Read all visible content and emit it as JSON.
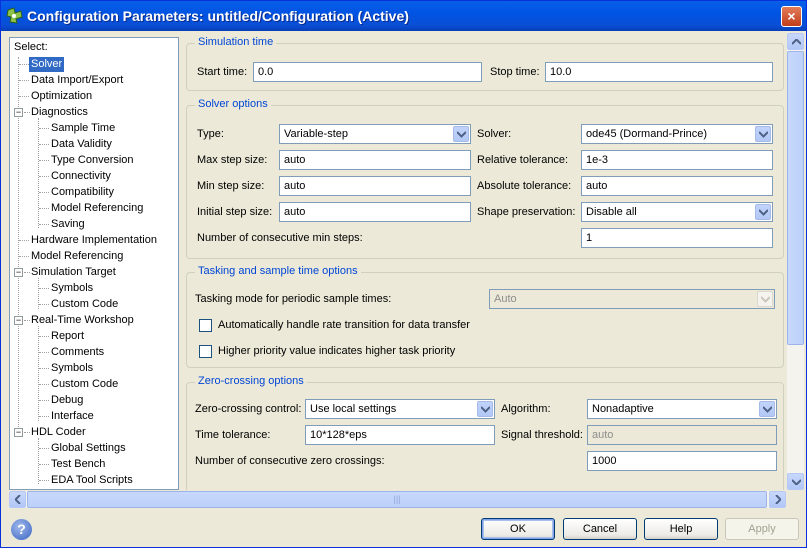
{
  "window": {
    "title": "Configuration Parameters: untitled/Configuration (Active)",
    "close": "×"
  },
  "tree": {
    "header": "Select:",
    "items": [
      {
        "label": "Solver"
      },
      {
        "label": "Data Import/Export"
      },
      {
        "label": "Optimization"
      },
      {
        "label": "Diagnostics"
      },
      {
        "label": "Sample Time"
      },
      {
        "label": "Data Validity"
      },
      {
        "label": "Type Conversion"
      },
      {
        "label": "Connectivity"
      },
      {
        "label": "Compatibility"
      },
      {
        "label": "Model Referencing"
      },
      {
        "label": "Saving"
      },
      {
        "label": "Hardware Implementation"
      },
      {
        "label": "Model Referencing"
      },
      {
        "label": "Simulation Target"
      },
      {
        "label": "Symbols"
      },
      {
        "label": "Custom Code"
      },
      {
        "label": "Real-Time Workshop"
      },
      {
        "label": "Report"
      },
      {
        "label": "Comments"
      },
      {
        "label": "Symbols"
      },
      {
        "label": "Custom Code"
      },
      {
        "label": "Debug"
      },
      {
        "label": "Interface"
      },
      {
        "label": "HDL Coder"
      },
      {
        "label": "Global Settings"
      },
      {
        "label": "Test Bench"
      },
      {
        "label": "EDA Tool Scripts"
      }
    ],
    "expander": "−"
  },
  "simulation_time": {
    "title": "Simulation time",
    "start_label": "Start time:",
    "start_value": "0.0",
    "stop_label": "Stop time:",
    "stop_value": "10.0"
  },
  "solver_options": {
    "title": "Solver options",
    "type_label": "Type:",
    "type_value": "Variable-step",
    "solver_label": "Solver:",
    "solver_value": "ode45 (Dormand-Prince)",
    "max_step_label": "Max step size:",
    "max_step_value": "auto",
    "rel_tol_label": "Relative tolerance:",
    "rel_tol_value": "1e-3",
    "min_step_label": "Min step size:",
    "min_step_value": "auto",
    "abs_tol_label": "Absolute tolerance:",
    "abs_tol_value": "auto",
    "init_step_label": "Initial step size:",
    "init_step_value": "auto",
    "shape_label": "Shape preservation:",
    "shape_value": "Disable all",
    "consec_label": "Number of consecutive min steps:",
    "consec_value": "1"
  },
  "tasking": {
    "title": "Tasking and sample time options",
    "mode_label": "Tasking mode for periodic sample times:",
    "mode_value": "Auto",
    "rate_label": "Automatically handle rate transition for data transfer",
    "priority_label": "Higher priority value indicates higher task priority"
  },
  "zero_crossing": {
    "title": "Zero-crossing options",
    "control_label": "Zero-crossing control:",
    "control_value": "Use local settings",
    "algo_label": "Algorithm:",
    "algo_value": "Nonadaptive",
    "tol_label": "Time tolerance:",
    "tol_value": "10*128*eps",
    "thresh_label": "Signal threshold:",
    "thresh_value": "auto",
    "consec_label": "Number of consecutive zero crossings:",
    "consec_value": "1000"
  },
  "hscroll": {
    "grip": "|||"
  },
  "buttons": {
    "help_icon": "?",
    "ok": "OK",
    "cancel": "Cancel",
    "help": "Help",
    "apply": "Apply"
  }
}
